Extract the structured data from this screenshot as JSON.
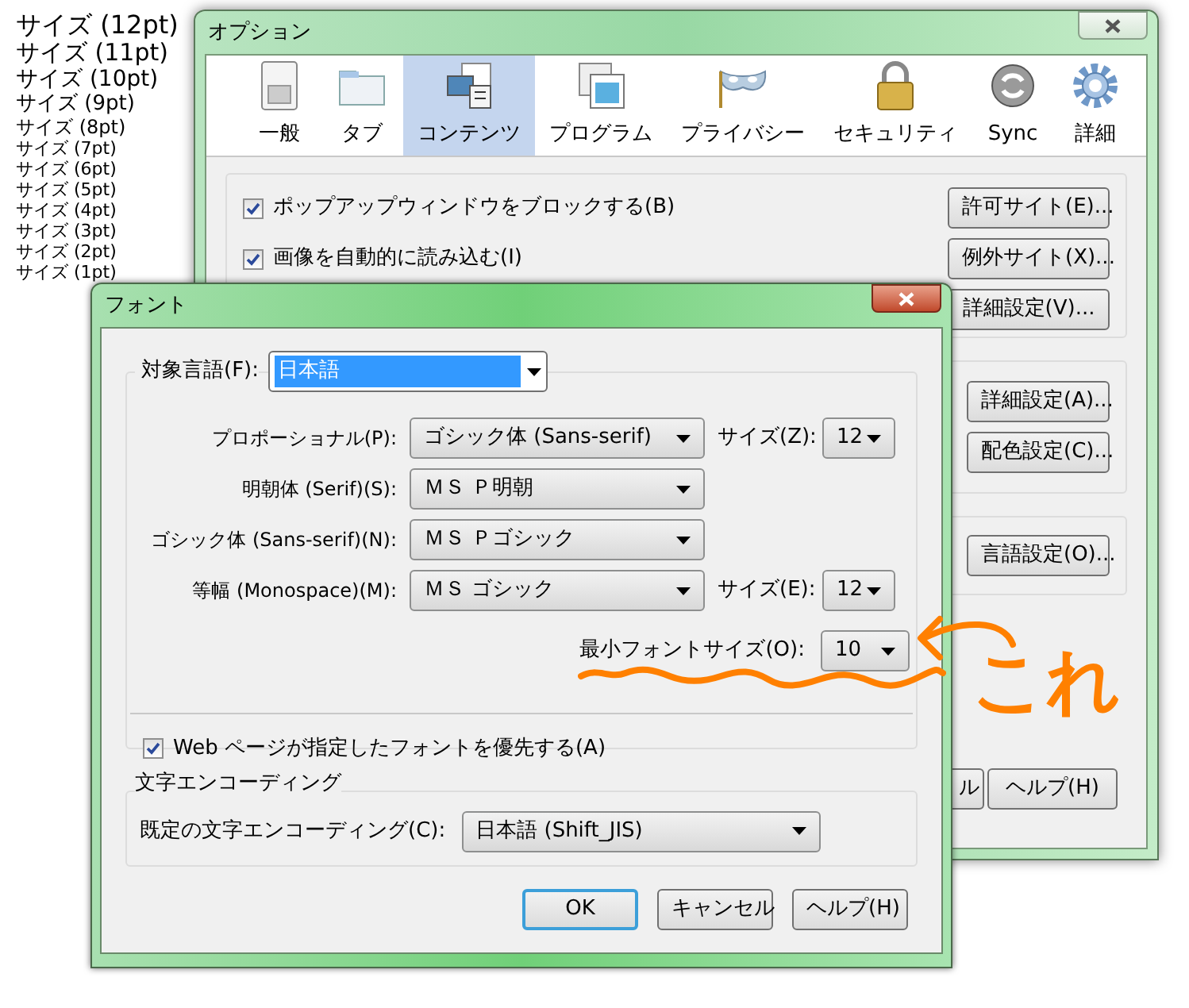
{
  "size_samples": [
    "サイズ (12pt)",
    "サイズ (11pt)",
    "サイズ (10pt)",
    "サイズ (9pt)",
    "サイズ (8pt)",
    "サイズ (7pt)",
    "サイズ (6pt)",
    "サイズ (5pt)",
    "サイズ (4pt)",
    "サイズ (3pt)",
    "サイズ (2pt)",
    "サイズ (1pt)"
  ],
  "options_window": {
    "title": "オプション",
    "tabs": [
      {
        "label": "一般",
        "selected": false
      },
      {
        "label": "タブ",
        "selected": false
      },
      {
        "label": "コンテンツ",
        "selected": true
      },
      {
        "label": "プログラム",
        "selected": false
      },
      {
        "label": "プライバシー",
        "selected": false
      },
      {
        "label": "セキュリティ",
        "selected": false
      },
      {
        "label": "Sync",
        "selected": false
      },
      {
        "label": "詳細",
        "selected": false
      }
    ],
    "content_rows": [
      {
        "label": "ポップアップウィンドウをブロックする(B)",
        "checked": true,
        "button": "許可サイト(E)..."
      },
      {
        "label": "画像を自動的に読み込む(I)",
        "checked": true,
        "button": "例外サイト(X)..."
      },
      {
        "button": "詳細設定(V)..."
      }
    ],
    "font_group_buttons": [
      "詳細設定(A)...",
      "配色設定(C)..."
    ],
    "language_group_buttons": [
      "言語設定(O)..."
    ],
    "footer_buttons": [
      "ル",
      "ヘルプ(H)"
    ]
  },
  "font_dialog": {
    "title": "フォント",
    "language": {
      "label": "対象言語(F):",
      "value": "日本語"
    },
    "font_rows": [
      {
        "label": "プロポーショナル(P):",
        "value": "ゴシック体 (Sans-serif)",
        "size_label": "サイズ(Z):",
        "size": "12"
      },
      {
        "label": "明朝体 (Serif)(S):",
        "value": "ＭＳ Ｐ明朝"
      },
      {
        "label": "ゴシック体 (Sans-serif)(N):",
        "value": "ＭＳ Ｐゴシック"
      },
      {
        "label": "等幅 (Monospace)(M):",
        "value": "ＭＳ ゴシック",
        "size_label": "サイズ(E):",
        "size": "12"
      }
    ],
    "min_size": {
      "label": "最小フォントサイズ(O):",
      "value": "10"
    },
    "allow_page_fonts": {
      "label": "Web ページが指定したフォントを優先する(A)",
      "checked": true
    },
    "encoding": {
      "title": "文字エンコーディング",
      "label": "既定の文字エンコーディング(C):",
      "value": "日本語 (Shift_JIS)"
    },
    "buttons": [
      {
        "label": "OK",
        "default": true
      },
      {
        "label": "キャンセル",
        "default": false
      },
      {
        "label": "ヘルプ(H)",
        "default": false
      }
    ]
  },
  "annotation": {
    "text": "これ"
  }
}
